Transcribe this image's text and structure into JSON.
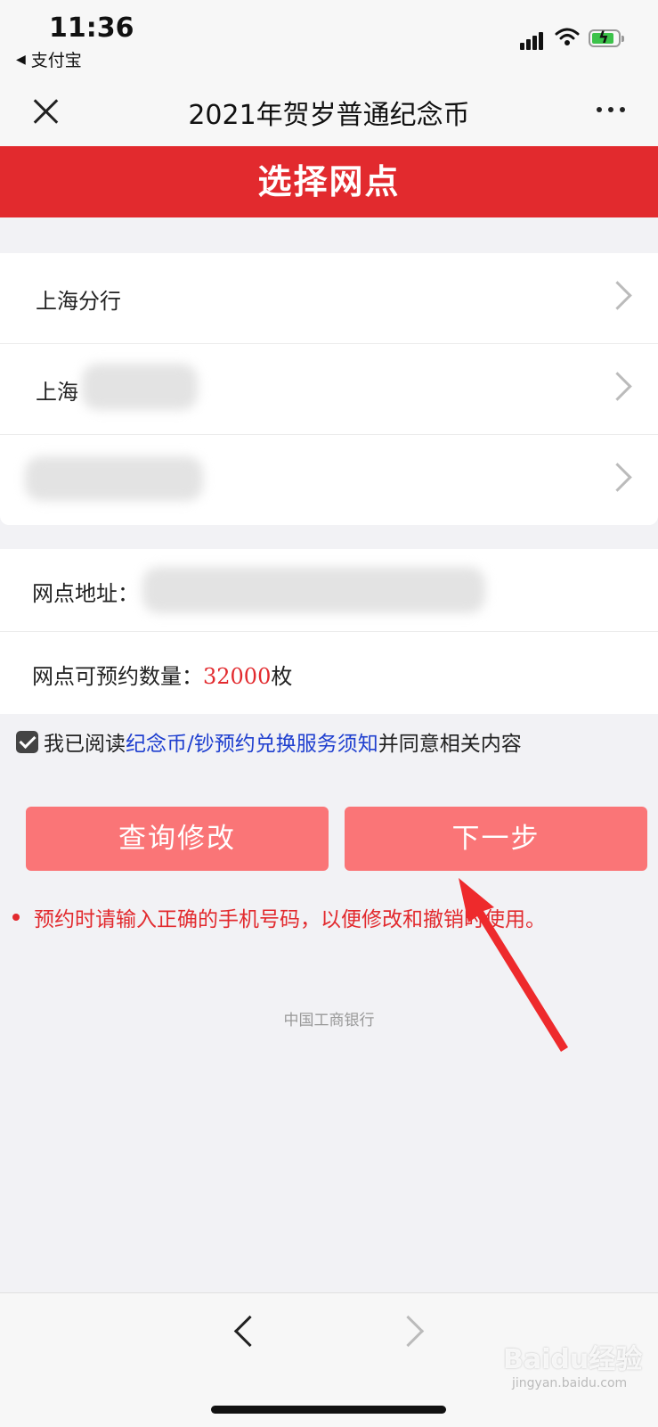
{
  "status_bar": {
    "time": "11:36",
    "back_app": "支付宝"
  },
  "nav": {
    "title": "2021年贺岁普通纪念币"
  },
  "header": {
    "title": "选择网点"
  },
  "branches": [
    {
      "label": "上海分行"
    },
    {
      "label": "上海"
    },
    {
      "label": ""
    }
  ],
  "info": {
    "address_label": "网点地址：",
    "quota_label": "网点可预约数量：",
    "quota_value": "32000",
    "quota_unit": "枚"
  },
  "agreement": {
    "prefix": "我已阅读",
    "link": "纪念币/钞预约兑换服务须知",
    "suffix": "并同意相关内容",
    "checked": true
  },
  "buttons": {
    "query": "查询修改",
    "next": "下一步"
  },
  "note": "预约时请输入正确的手机号码，以便修改和撤销时使用。",
  "footer": "中国工商银行",
  "watermark": {
    "brand": "Baidu经验",
    "url": "jingyan.baidu.com"
  },
  "colors": {
    "brand_red": "#e22a2e",
    "button": "#fa7577",
    "link": "#1f3fcf"
  }
}
